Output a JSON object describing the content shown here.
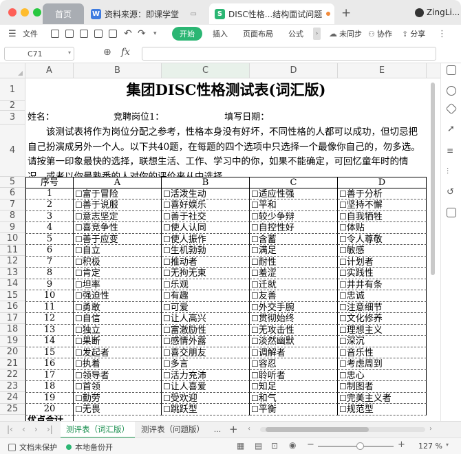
{
  "window": {
    "tabs": [
      {
        "label": "首页"
      },
      {
        "label": "资料来源：即课学堂"
      },
      {
        "label": "DISC性格...结构面试问题"
      }
    ],
    "user": "ZingLi..."
  },
  "toolbar": {
    "file": "文件",
    "start": "开始",
    "insert": "插入",
    "page_layout": "页面布局",
    "formula": "公式",
    "sync": "未同步",
    "collab": "协作",
    "share": "分享"
  },
  "formula_bar": {
    "cell_ref": "C71",
    "fx": "fx",
    "value": ""
  },
  "columns": [
    "A",
    "B",
    "C",
    "D",
    "E"
  ],
  "rows_visible": [
    "1",
    "2",
    "3",
    "4",
    "5",
    "6",
    "7",
    "8",
    "9",
    "10",
    "11",
    "12",
    "13",
    "14",
    "15",
    "16",
    "17",
    "18",
    "19",
    "20",
    "21",
    "22",
    "23",
    "24",
    "25"
  ],
  "sheet": {
    "title": "集团DISC性格测试表(词汇版)",
    "info_name": "姓名：",
    "info_position": "竞聘岗位1：",
    "info_date": "填写日期：",
    "intro": "该测试表将作为岗位分配之参考，性格本身没有好坏，不同性格的人都可以成功，但切忌把自己扮演成另外一个人。以下共40题，在每题的四个选项中只选择一个最像你自己的，勿多选。请按第一印象最快的选择，联想生活、工作、学习中的你，如果不能确定，可回忆童年时的情况，或者以你最熟悉的人对你的评价来从中选择。",
    "header": [
      "序号",
      "A",
      "B",
      "C",
      "D"
    ],
    "questions": [
      {
        "no": "1",
        "a": "富于冒险",
        "b": "活泼生动",
        "c": "适应性强",
        "d": "善于分析"
      },
      {
        "no": "2",
        "a": "善于说服",
        "b": "喜好娱乐",
        "c": "平和",
        "d": "坚持不懈"
      },
      {
        "no": "3",
        "a": "意志坚定",
        "b": "善于社交",
        "c": "较少争辩",
        "d": "自我牺牲"
      },
      {
        "no": "4",
        "a": "喜竞争性",
        "b": "使人认同",
        "c": "自控性好",
        "d": "体贴"
      },
      {
        "no": "5",
        "a": "善于应变",
        "b": "使人振作",
        "c": "含蓄",
        "d": "令人尊敬"
      },
      {
        "no": "6",
        "a": "自立",
        "b": "生机勃勃",
        "c": "满足",
        "d": "敏感"
      },
      {
        "no": "7",
        "a": "积极",
        "b": "推动者",
        "c": "耐性",
        "d": "计划者"
      },
      {
        "no": "8",
        "a": "肯定",
        "b": "无拘无束",
        "c": "羞涩",
        "d": "实践性"
      },
      {
        "no": "9",
        "a": "坦率",
        "b": "乐观",
        "c": "迁就",
        "d": "井井有条"
      },
      {
        "no": "10",
        "a": "强迫性",
        "b": "有趣",
        "c": "友善",
        "d": "忠诚"
      },
      {
        "no": "11",
        "a": "勇敢",
        "b": "可爱",
        "c": "外交手腕",
        "d": "注意细节"
      },
      {
        "no": "12",
        "a": "自信",
        "b": "让人高兴",
        "c": "贯彻始终",
        "d": "文化修养"
      },
      {
        "no": "13",
        "a": "独立",
        "b": "富激励性",
        "c": "无攻击性",
        "d": "理想主义"
      },
      {
        "no": "14",
        "a": "果断",
        "b": "感情外露",
        "c": "淡然幽默",
        "d": "深沉"
      },
      {
        "no": "15",
        "a": "发起者",
        "b": "喜交朋友",
        "c": "调解者",
        "d": "音乐性"
      },
      {
        "no": "16",
        "a": "执着",
        "b": "多言",
        "c": "容忍",
        "d": "考虑周到"
      },
      {
        "no": "17",
        "a": "领导者",
        "b": "活力充沛",
        "c": "聆听者",
        "d": "忠心"
      },
      {
        "no": "18",
        "a": "首领",
        "b": "让人喜爱",
        "c": "知足",
        "d": "制图者"
      },
      {
        "no": "19",
        "a": "勤劳",
        "b": "受欢迎",
        "c": "和气",
        "d": "完美主义者"
      },
      {
        "no": "20",
        "a": "无畏",
        "b": "跳跃型",
        "c": "平衡",
        "d": "规范型"
      }
    ],
    "footer_partial": "优点合计"
  },
  "sheet_tabs": [
    {
      "label": "测评表（词汇版）",
      "active": true
    },
    {
      "label": "测评表（问题版）",
      "active": false
    },
    {
      "label": "...",
      "active": false
    }
  ],
  "status": {
    "protect": "文档未保护",
    "backup": "本地备份开",
    "zoom": "127 %"
  },
  "colors": {
    "accent_green": "#2bb673",
    "sheet_tab_green": "#1f9d55",
    "tab_active_text": "#1a8f4f"
  }
}
